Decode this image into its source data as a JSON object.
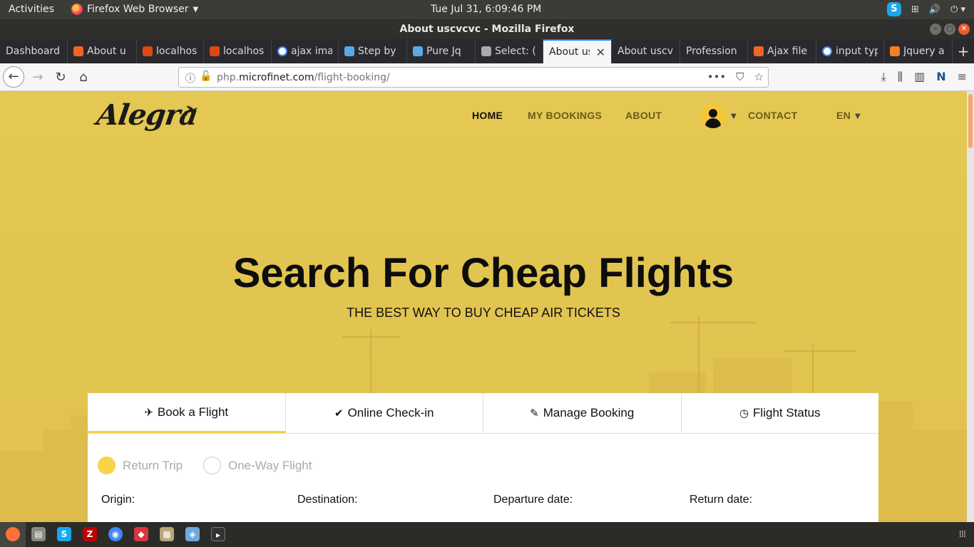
{
  "topbar": {
    "activities": "Activities",
    "app_name": "Firefox Web Browser",
    "clock": "Tue Jul 31,  6:09:46 PM"
  },
  "window": {
    "title": "About uscvcvc - Mozilla Firefox"
  },
  "tabs": [
    {
      "label": "Dashboard",
      "icon": "dashboard-icon",
      "color": "#555555"
    },
    {
      "label": "About u",
      "icon": "xampp-icon",
      "color": "#f26522"
    },
    {
      "label": "localhos",
      "icon": "codeigniter-icon",
      "color": "#dd4814"
    },
    {
      "label": "localhos",
      "icon": "codeigniter-icon",
      "color": "#dd4814"
    },
    {
      "label": "ajax ima",
      "icon": "google-icon",
      "color": "#ffffff"
    },
    {
      "label": "Step by",
      "icon": "w3-icon",
      "color": "#5aa9e6"
    },
    {
      "label": "Pure Jq",
      "icon": "w3-icon",
      "color": "#5aa9e6"
    },
    {
      "label": "Select: (",
      "icon": "select-icon",
      "color": "#aaaaaa"
    },
    {
      "label": "About us",
      "icon": "",
      "color": "#f6f6f6",
      "active": true
    },
    {
      "label": "About uscv",
      "icon": "",
      "color": ""
    },
    {
      "label": "Profession",
      "icon": "",
      "color": ""
    },
    {
      "label": "Ajax file",
      "icon": "xampp-icon",
      "color": "#f26522"
    },
    {
      "label": "input typ",
      "icon": "google-icon",
      "color": "#ffffff"
    },
    {
      "label": "Jquery a",
      "icon": "stackoverflow-icon",
      "color": "#f48024"
    }
  ],
  "urlbar": {
    "url_prefix": "php.",
    "url_domain": "microfinet.com",
    "url_path": "/flight-booking/"
  },
  "site": {
    "logo": "Alegra",
    "nav": {
      "home": "HOME",
      "bookings": "MY BOOKINGS",
      "about": "ABOUT",
      "contact": "CONTACT",
      "lang": "EN"
    },
    "hero_title": "Search For Cheap Flights",
    "hero_subtitle": "THE BEST WAY TO BUY CHEAP AIR TICKETS"
  },
  "booking": {
    "tabs": [
      {
        "label": "Book a Flight",
        "icon": "plane-icon"
      },
      {
        "label": "Online Check-in",
        "icon": "check-icon"
      },
      {
        "label": "Manage Booking",
        "icon": "edit-icon"
      },
      {
        "label": "Flight Status",
        "icon": "clock-icon"
      }
    ],
    "trip_types": [
      "Return Trip",
      "One-Way Flight"
    ],
    "fields": [
      "Origin:",
      "Destination:",
      "Departure date:",
      "Return date:"
    ]
  },
  "colors": {
    "hero_overlay": "#e7cb55",
    "accent_yellow": "#f7d44a",
    "firefox_accent": "#0a84ff"
  }
}
